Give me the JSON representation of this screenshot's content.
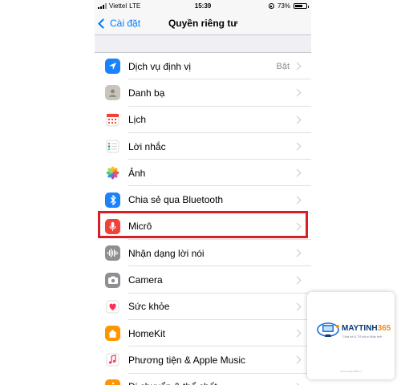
{
  "status_bar": {
    "carrier": "Viettel",
    "network": "LTE",
    "time": "15:39",
    "battery": "73%",
    "battery_level": 0.73
  },
  "nav": {
    "back_label": "Cài đặt",
    "title": "Quyền riêng tư"
  },
  "rows": [
    {
      "label": "Dịch vụ định vị",
      "value": "Bật",
      "icon": "location-arrow-icon",
      "color": "#1a82fb"
    },
    {
      "label": "Danh bạ",
      "value": "",
      "icon": "contacts-icon",
      "color": "#c9c4bb"
    },
    {
      "label": "Lịch",
      "value": "",
      "icon": "calendar-icon",
      "color": "#ffffff"
    },
    {
      "label": "Lời nhắc",
      "value": "",
      "icon": "reminders-icon",
      "color": "#ffffff"
    },
    {
      "label": "Ảnh",
      "value": "",
      "icon": "photos-icon",
      "color": "#ffffff"
    },
    {
      "label": "Chia sẻ qua Bluetooth",
      "value": "",
      "icon": "bluetooth-icon",
      "color": "#1a82fb"
    },
    {
      "label": "Micrô",
      "value": "",
      "icon": "microphone-icon",
      "color": "#f24236"
    },
    {
      "label": "Nhận dạng lời nói",
      "value": "",
      "icon": "waveform-icon",
      "color": "#8e8e93"
    },
    {
      "label": "Camera",
      "value": "",
      "icon": "camera-icon",
      "color": "#8e8e93"
    },
    {
      "label": "Sức khỏe",
      "value": "",
      "icon": "health-heart-icon",
      "color": "#ffffff"
    },
    {
      "label": "HomeKit",
      "value": "",
      "icon": "home-icon",
      "color": "#ff9500"
    },
    {
      "label": "Phương tiện & Apple Music",
      "value": "",
      "icon": "music-note-icon",
      "color": "#ffffff"
    },
    {
      "label": "Di chuyển & thể chất",
      "value": "",
      "icon": "motion-icon",
      "color": "#ff9500"
    }
  ],
  "watermark": {
    "brand": "MAYTINH",
    "brand_num": "365",
    "tagline": "Chia sẻ & Tổ chức Máy tính",
    "url": "www.maytinh365.vn"
  },
  "highlight_color": "#d81f26"
}
